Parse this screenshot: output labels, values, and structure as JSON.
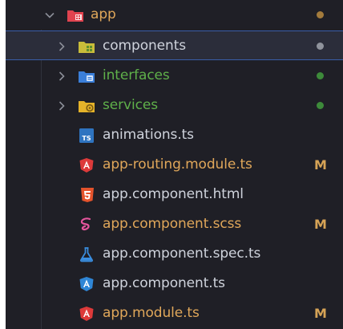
{
  "colors": {
    "background": "#1f1f26",
    "selected_background": "#2b2d3a",
    "selected_border": "#3a5ea8",
    "text_default": "#cfd3dc",
    "text_modified": "#e0a75a",
    "text_untracked": "#5fb04a",
    "dot_modified": "#a37b3c",
    "dot_default": "#8f939c",
    "dot_untracked": "#3d8a3a",
    "chevron": "#8b8e98",
    "badge_modified": "#d6a356"
  },
  "tree": {
    "root": {
      "label": "app",
      "expanded": true,
      "icon": "app-folder-icon"
    },
    "items": [
      {
        "label": "components",
        "type": "folder",
        "icon": "components-folder-icon"
      },
      {
        "label": "interfaces",
        "type": "folder",
        "icon": "interfaces-folder-icon"
      },
      {
        "label": "services",
        "type": "folder",
        "icon": "services-folder-icon"
      },
      {
        "label": "animations.ts",
        "type": "file",
        "icon": "typescript-icon"
      },
      {
        "label": "app-routing.module.ts",
        "type": "file",
        "icon": "angular-icon",
        "badge": "M"
      },
      {
        "label": "app.component.html",
        "type": "file",
        "icon": "html-icon"
      },
      {
        "label": "app.component.scss",
        "type": "file",
        "icon": "sass-icon",
        "badge": "M"
      },
      {
        "label": "app.component.spec.ts",
        "type": "file",
        "icon": "test-flask-icon"
      },
      {
        "label": "app.component.ts",
        "type": "file",
        "icon": "angular-component-icon"
      },
      {
        "label": "app.module.ts",
        "type": "file",
        "icon": "angular-icon",
        "badge": "M"
      }
    ]
  }
}
